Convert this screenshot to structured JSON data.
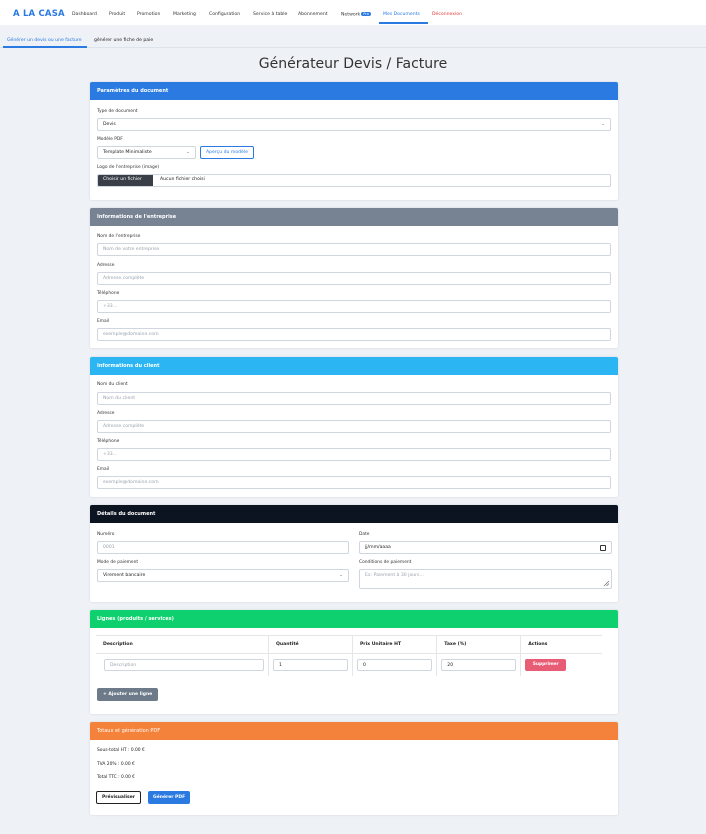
{
  "nav": {
    "brand": "A LA CASA",
    "items": [
      {
        "label": "Dashboard"
      },
      {
        "label": "Produit"
      },
      {
        "label": "Promotion"
      },
      {
        "label": "Marketing"
      },
      {
        "label": "Configuration"
      },
      {
        "label": "Service à table"
      },
      {
        "label": "Abonnement"
      },
      {
        "label": "Network",
        "badge": "Pro"
      },
      {
        "label": "Mes Documents"
      },
      {
        "label": "Déconnexion"
      }
    ],
    "active_color": "#2a7ae2",
    "logout_color": "#e23b3b"
  },
  "subtabs": [
    {
      "label": "Générer un devis ou une facture"
    },
    {
      "label": "générer une fiche de paie"
    }
  ],
  "page_title": "Générateur Devis / Facture",
  "doc_params": {
    "header": "Paramètres du document",
    "header_color": "#2a7ae2",
    "type_label": "Type de document",
    "type_value": "Devis",
    "model_label": "Modèle PDF",
    "model_value": "Template Minimaliste",
    "preview_button": "Aperçu du modèle",
    "logo_label": "Logo de l'entreprise (image)",
    "file_button": "Choisir un fichier",
    "file_status": "Aucun fichier choisi"
  },
  "company": {
    "header": "Informations de l'entreprise",
    "header_color": "#778292",
    "name_label": "Nom de l'entreprise",
    "name_placeholder": "Nom de votre entreprise",
    "address_label": "Adresse",
    "address_placeholder": "Adresse complète",
    "phone_label": "Téléphone",
    "phone_placeholder": "+33...",
    "email_label": "Email",
    "email_placeholder": "exemple@domaine.com"
  },
  "client": {
    "header": "Informations du client",
    "header_color": "#2bb6f3",
    "name_label": "Nom du client",
    "name_placeholder": "Nom du client",
    "address_label": "Adresse",
    "address_placeholder": "Adresse complète",
    "phone_label": "Téléphone",
    "phone_placeholder": "+33...",
    "email_label": "Email",
    "email_placeholder": "exemple@domaine.com"
  },
  "details": {
    "header": "Détails du document",
    "header_color": "#0d1421",
    "number_label": "Numéro",
    "number_placeholder": "0001",
    "date_label": "Date",
    "date_placeholder": "jj/mm/aaaa",
    "payment_label": "Mode de paiement",
    "payment_value": "Virement bancaire",
    "conditions_label": "Conditions de paiement",
    "conditions_placeholder": "Ex: Paiement à 30 jours..."
  },
  "lines": {
    "header": "Lignes (produits / services)",
    "header_color": "#0ed06e",
    "columns": [
      "Description",
      "Quantité",
      "Prix Unitaire HT",
      "Taxe (%)",
      "Actions"
    ],
    "row": {
      "description_placeholder": "Description",
      "quantity": "1",
      "unit_price": "0",
      "tax": "20",
      "delete_label": "Supprimer"
    },
    "delete_color": "#e85c76",
    "add_button": "+ Ajouter une ligne"
  },
  "totals": {
    "header": "Totaux et génération PDF",
    "header_color": "#f4823a",
    "subtotal": "Sous-total HT : 0.00 €",
    "vat": "TVA 20% : 0.00 €",
    "total": "Total TTC : 0.00 €",
    "preview_button": "Prévisualiser",
    "pdf_button": "Générer PDF"
  }
}
